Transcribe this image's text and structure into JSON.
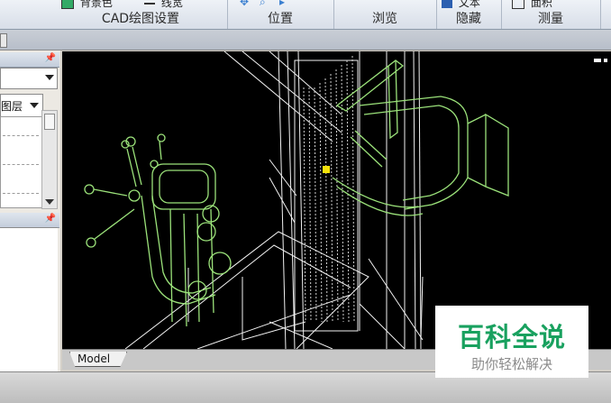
{
  "ribbon": {
    "groups": [
      {
        "label": "CAD绘图设置",
        "buttons": [
          "背景色",
          "线宽"
        ]
      },
      {
        "label": "位置",
        "buttons": []
      },
      {
        "label": "浏览",
        "buttons": []
      },
      {
        "label": "隐藏",
        "buttons": [
          "文本"
        ]
      },
      {
        "label": "测量",
        "buttons": [
          "面积"
        ]
      }
    ]
  },
  "left_panel": {
    "layer_combo": "图层"
  },
  "viewport": {
    "tab": "Model"
  },
  "watermark": {
    "title": "百科全说",
    "subtitle": "助你轻松解决"
  },
  "colors": {
    "viewport_bg": "#000000",
    "wire_green": "#9be27a",
    "wire_white": "#f2f2f2",
    "marker": "#f5e20a",
    "watermark_green": "#19a15f"
  }
}
